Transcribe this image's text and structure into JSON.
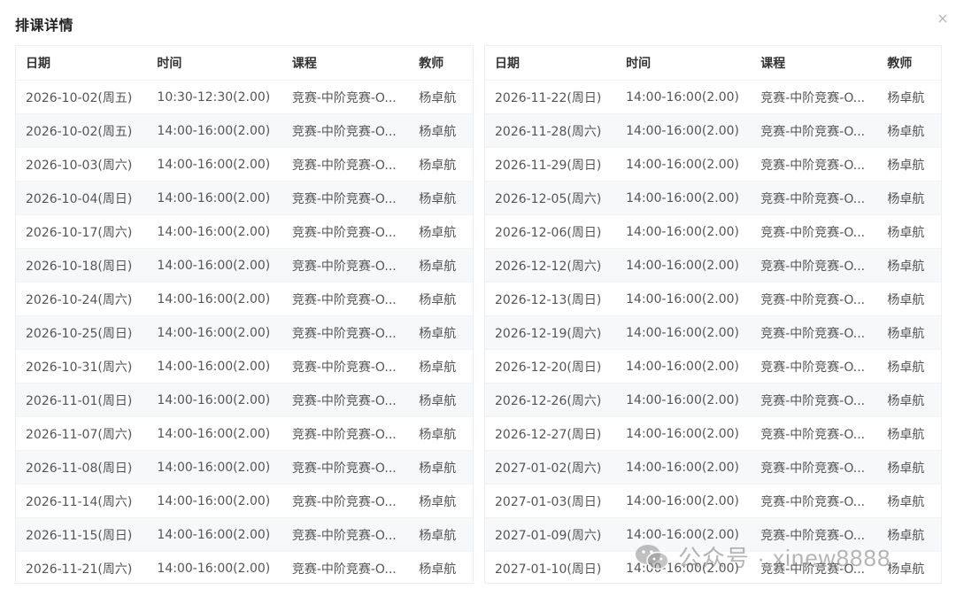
{
  "dialog": {
    "title": "排课详情",
    "close_glyph": "×"
  },
  "columns": [
    "日期",
    "时间",
    "课程",
    "教师"
  ],
  "tables": [
    {
      "rows": [
        [
          "2026-10-02(周五)",
          "10:30-12:30(2.00)",
          "竞赛-中阶竞赛-O...",
          "杨卓航"
        ],
        [
          "2026-10-02(周五)",
          "14:00-16:00(2.00)",
          "竞赛-中阶竞赛-O...",
          "杨卓航"
        ],
        [
          "2026-10-03(周六)",
          "14:00-16:00(2.00)",
          "竞赛-中阶竞赛-O...",
          "杨卓航"
        ],
        [
          "2026-10-04(周日)",
          "14:00-16:00(2.00)",
          "竞赛-中阶竞赛-O...",
          "杨卓航"
        ],
        [
          "2026-10-17(周六)",
          "14:00-16:00(2.00)",
          "竞赛-中阶竞赛-O...",
          "杨卓航"
        ],
        [
          "2026-10-18(周日)",
          "14:00-16:00(2.00)",
          "竞赛-中阶竞赛-O...",
          "杨卓航"
        ],
        [
          "2026-10-24(周六)",
          "14:00-16:00(2.00)",
          "竞赛-中阶竞赛-O...",
          "杨卓航"
        ],
        [
          "2026-10-25(周日)",
          "14:00-16:00(2.00)",
          "竞赛-中阶竞赛-O...",
          "杨卓航"
        ],
        [
          "2026-10-31(周六)",
          "14:00-16:00(2.00)",
          "竞赛-中阶竞赛-O...",
          "杨卓航"
        ],
        [
          "2026-11-01(周日)",
          "14:00-16:00(2.00)",
          "竞赛-中阶竞赛-O...",
          "杨卓航"
        ],
        [
          "2026-11-07(周六)",
          "14:00-16:00(2.00)",
          "竞赛-中阶竞赛-O...",
          "杨卓航"
        ],
        [
          "2026-11-08(周日)",
          "14:00-16:00(2.00)",
          "竞赛-中阶竞赛-O...",
          "杨卓航"
        ],
        [
          "2026-11-14(周六)",
          "14:00-16:00(2.00)",
          "竞赛-中阶竞赛-O...",
          "杨卓航"
        ],
        [
          "2026-11-15(周日)",
          "14:00-16:00(2.00)",
          "竞赛-中阶竞赛-O...",
          "杨卓航"
        ],
        [
          "2026-11-21(周六)",
          "14:00-16:00(2.00)",
          "竞赛-中阶竞赛-O...",
          "杨卓航"
        ]
      ]
    },
    {
      "rows": [
        [
          "2026-11-22(周日)",
          "14:00-16:00(2.00)",
          "竞赛-中阶竞赛-O...",
          "杨卓航"
        ],
        [
          "2026-11-28(周六)",
          "14:00-16:00(2.00)",
          "竞赛-中阶竞赛-O...",
          "杨卓航"
        ],
        [
          "2026-11-29(周日)",
          "14:00-16:00(2.00)",
          "竞赛-中阶竞赛-O...",
          "杨卓航"
        ],
        [
          "2026-12-05(周六)",
          "14:00-16:00(2.00)",
          "竞赛-中阶竞赛-O...",
          "杨卓航"
        ],
        [
          "2026-12-06(周日)",
          "14:00-16:00(2.00)",
          "竞赛-中阶竞赛-O...",
          "杨卓航"
        ],
        [
          "2026-12-12(周六)",
          "14:00-16:00(2.00)",
          "竞赛-中阶竞赛-O...",
          "杨卓航"
        ],
        [
          "2026-12-13(周日)",
          "14:00-16:00(2.00)",
          "竞赛-中阶竞赛-O...",
          "杨卓航"
        ],
        [
          "2026-12-19(周六)",
          "14:00-16:00(2.00)",
          "竞赛-中阶竞赛-O...",
          "杨卓航"
        ],
        [
          "2026-12-20(周日)",
          "14:00-16:00(2.00)",
          "竞赛-中阶竞赛-O...",
          "杨卓航"
        ],
        [
          "2026-12-26(周六)",
          "14:00-16:00(2.00)",
          "竞赛-中阶竞赛-O...",
          "杨卓航"
        ],
        [
          "2026-12-27(周日)",
          "14:00-16:00(2.00)",
          "竞赛-中阶竞赛-O...",
          "杨卓航"
        ],
        [
          "2027-01-02(周六)",
          "14:00-16:00(2.00)",
          "竞赛-中阶竞赛-O...",
          "杨卓航"
        ],
        [
          "2027-01-03(周日)",
          "14:00-16:00(2.00)",
          "竞赛-中阶竞赛-O...",
          "杨卓航"
        ],
        [
          "2027-01-09(周六)",
          "14:00-16:00(2.00)",
          "竞赛-中阶竞赛-O...",
          "杨卓航"
        ],
        [
          "2027-01-10(周日)",
          "14:00-16:00(2.00)",
          "竞赛-中阶竞赛-O...",
          "杨卓航"
        ]
      ]
    }
  ],
  "watermark": {
    "text": "公众号 · xinew8888",
    "icon": "wechat-icon"
  },
  "colors": {
    "border": "#ebeef5",
    "stripe": "#f7f8fa",
    "header_text": "#333333",
    "cell_text": "#555555"
  }
}
